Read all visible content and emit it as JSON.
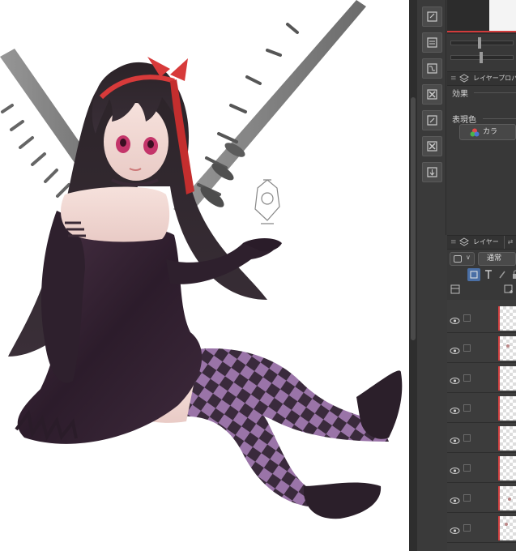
{
  "panel": {
    "layer_property_tab": "レイヤープロパ",
    "effect_label": "効果",
    "expression_color_label": "表現色",
    "color_button_label": "カラ",
    "layer_tab": "レイヤー",
    "blend_mode": "通常"
  },
  "tool_icons": [
    "new-page-icon",
    "page-icon",
    "merge-icon",
    "delete-icon",
    "edit-icon",
    "close-box-icon",
    "export-icon"
  ],
  "layers": [
    {
      "visible": true
    },
    {
      "visible": true
    },
    {
      "visible": true
    },
    {
      "visible": true
    },
    {
      "visible": true
    },
    {
      "visible": true
    },
    {
      "visible": true
    },
    {
      "visible": true
    }
  ],
  "colors": {
    "panel_bg": "#3a3a3a",
    "accent_red": "#d23b3b",
    "canvas_bg": "#ffffff"
  }
}
